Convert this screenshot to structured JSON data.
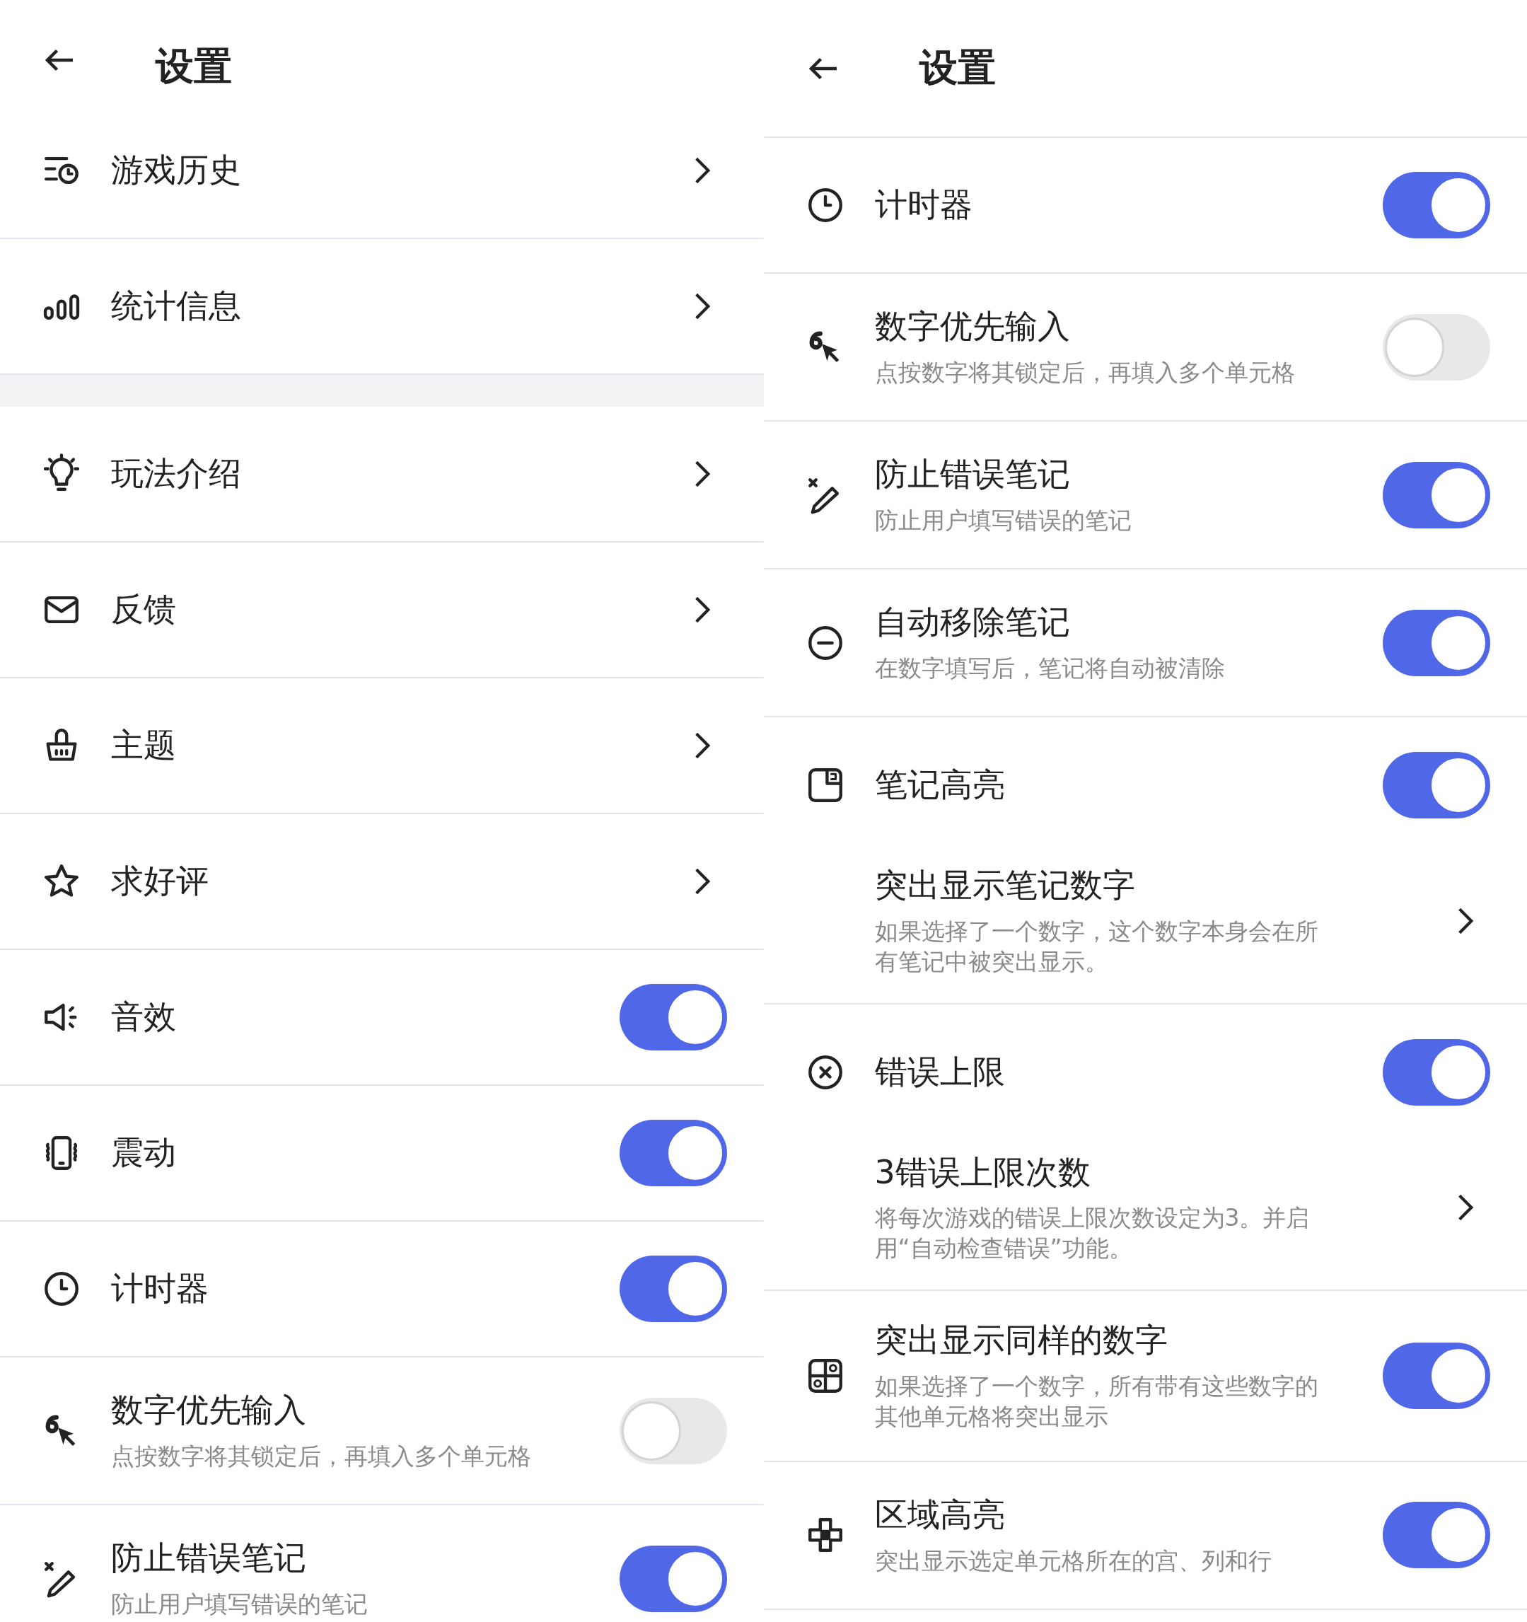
{
  "screens": [
    {
      "header": {
        "title": "设置"
      },
      "items": [
        {
          "kind": "link",
          "label": "游戏历史"
        },
        {
          "kind": "link",
          "label": "统计信息"
        },
        {
          "kind": "gap"
        },
        {
          "kind": "link",
          "label": "玩法介绍"
        },
        {
          "kind": "link",
          "label": "反馈"
        },
        {
          "kind": "link",
          "label": "主题"
        },
        {
          "kind": "link",
          "label": "求好评"
        },
        {
          "kind": "toggle",
          "label": "音效",
          "on": true
        },
        {
          "kind": "toggle",
          "label": "震动",
          "on": true
        },
        {
          "kind": "toggle",
          "label": "计时器",
          "on": true
        },
        {
          "kind": "toggle",
          "label": "数字优先输入",
          "description": "点按数字将其锁定后，再填入多个单元格",
          "on": false
        },
        {
          "kind": "toggle",
          "label": "防止错误笔记",
          "description": "防止用户填写错误的笔记",
          "on": true
        }
      ]
    },
    {
      "header": {
        "title": "设置"
      },
      "items": [
        {
          "kind": "toggle",
          "label": "计时器",
          "on": true
        },
        {
          "kind": "toggle",
          "label": "数字优先输入",
          "description": "点按数字将其锁定后，再填入多个单元格",
          "on": false
        },
        {
          "kind": "toggle",
          "label": "防止错误笔记",
          "description": "防止用户填写错误的笔记",
          "on": true
        },
        {
          "kind": "toggle",
          "label": "自动移除笔记",
          "description": "在数字填写后，笔记将自动被清除",
          "on": true
        },
        {
          "kind": "toggle",
          "label": "笔记高亮",
          "on": true
        },
        {
          "kind": "sub",
          "label": "突出显示笔记数字",
          "description": "如果选择了一个数字，这个数字本身会在所有笔记中被突出显示。"
        },
        {
          "kind": "toggle",
          "label": "错误上限",
          "on": true
        },
        {
          "kind": "sub",
          "label": "3错误上限次数",
          "description": "将每次游戏的错误上限次数设定为3。并启用“自动检查错误”功能。"
        },
        {
          "kind": "toggle",
          "label": "突出显示同样的数字",
          "description": "如果选择了一个数字，所有带有这些数字的其他单元格将突出显示",
          "on": true
        },
        {
          "kind": "toggle",
          "label": "区域高亮",
          "description": "突出显示选定单元格所在的宫、列和行",
          "on": true
        }
      ]
    }
  ]
}
